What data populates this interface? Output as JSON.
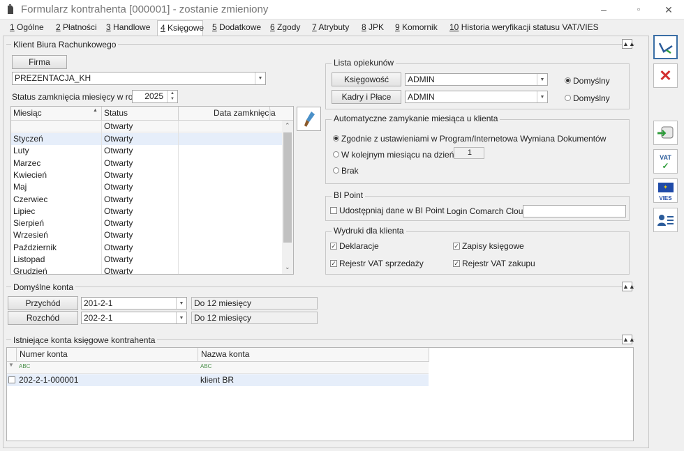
{
  "window": {
    "title": "Formularz kontrahenta [000001] - zostanie zmieniony",
    "minimize": "–",
    "maximize": "▫",
    "close": "✕"
  },
  "tabs": [
    {
      "num": "1",
      "label": "Ogólne"
    },
    {
      "num": "2",
      "label": "Płatności"
    },
    {
      "num": "3",
      "label": "Handlowe"
    },
    {
      "num": "4",
      "label": "Księgowe"
    },
    {
      "num": "5",
      "label": "Dodatkowe"
    },
    {
      "num": "6",
      "label": "Zgody"
    },
    {
      "num": "7",
      "label": "Atrybuty"
    },
    {
      "num": "8",
      "label": "JPK"
    },
    {
      "num": "9",
      "label": "Komornik"
    },
    {
      "num": "10",
      "label": "Historia weryfikacji statusu VAT/VIES"
    }
  ],
  "brk": {
    "title": "Klient Biura Rachunkowego",
    "firma_btn": "Firma",
    "firma_value": "PREZENTACJA_KH",
    "status_label": "Status zamknięcia miesięcy w roku",
    "year": "2025",
    "columns": [
      "Miesiąc",
      "Status",
      "Data zamknięcia"
    ],
    "filter_status": "Otwarty",
    "months": [
      {
        "m": "Styczeń",
        "s": "Otwarty"
      },
      {
        "m": "Luty",
        "s": "Otwarty"
      },
      {
        "m": "Marzec",
        "s": "Otwarty"
      },
      {
        "m": "Kwiecień",
        "s": "Otwarty"
      },
      {
        "m": "Maj",
        "s": "Otwarty"
      },
      {
        "m": "Czerwiec",
        "s": "Otwarty"
      },
      {
        "m": "Lipiec",
        "s": "Otwarty"
      },
      {
        "m": "Sierpień",
        "s": "Otwarty"
      },
      {
        "m": "Wrzesień",
        "s": "Otwarty"
      },
      {
        "m": "Październik",
        "s": "Otwarty"
      },
      {
        "m": "Listopad",
        "s": "Otwarty"
      },
      {
        "m": "Grudzień",
        "s": "Otwarty"
      }
    ]
  },
  "opiekunowie": {
    "title": "Lista opiekunów",
    "rows": [
      {
        "btn": "Księgowość",
        "value": "ADMIN",
        "radio": "Domyślny",
        "selected": true
      },
      {
        "btn": "Kadry i Płace",
        "value": "ADMIN",
        "radio": "Domyślny",
        "selected": false
      }
    ]
  },
  "auto": {
    "title": "Automatyczne zamykanie miesiąca u klienta",
    "opt1": "Zgodnie z ustawieniami w Program/Internetowa Wymiana Dokumentów",
    "opt2": "W kolejnym miesiącu na dzień",
    "day": "1",
    "opt3": "Brak"
  },
  "bipoint": {
    "title": "BI Point",
    "share": "Udostępniaj dane w BI Point",
    "login_label": "Login Comarch Cloud:",
    "login_value": ""
  },
  "wydruki": {
    "title": "Wydruki dla klienta",
    "items": [
      "Deklaracje",
      "Zapisy księgowe",
      "Rejestr VAT sprzedaży",
      "Rejestr VAT zakupu"
    ]
  },
  "konta": {
    "title": "Domyślne konta",
    "rows": [
      {
        "btn": "Przychód",
        "value": "201-2-1",
        "desc": "Do 12 miesięcy"
      },
      {
        "btn": "Rozchód",
        "value": "202-2-1",
        "desc": "Do 12 miesięcy"
      }
    ]
  },
  "istniejace": {
    "title": "Istniejące konta księgowe kontrahenta",
    "columns": [
      "Numer konta",
      "Nazwa konta"
    ],
    "filter_tag": "ABC",
    "rows": [
      {
        "num": "202-2-1-000001",
        "name": "klient BR"
      }
    ]
  },
  "sidebar": {
    "vat_label": "VAT",
    "vies_label": "VIES"
  },
  "colors": {
    "accent": "#3a6ea5",
    "selected_row": "#e6eefa",
    "close_red": "#d32f2f"
  }
}
